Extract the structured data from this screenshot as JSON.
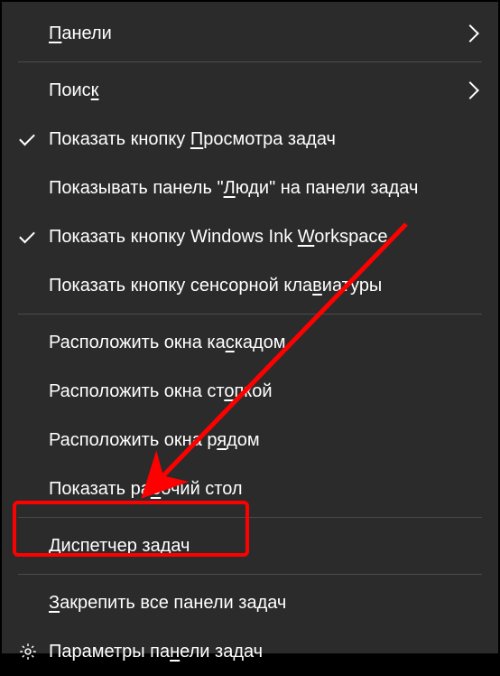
{
  "menu": {
    "panels": {
      "pre": "",
      "u": "П",
      "post": "анели"
    },
    "search": {
      "pre": "Поис",
      "u": "к",
      "post": ""
    },
    "taskview": {
      "pre": "Показать кнопку ",
      "u": "П",
      "post": "росмотра задач"
    },
    "people": {
      "pre": "Показывать панель \"",
      "u": "Л",
      "post": "юди\" на панели задач"
    },
    "ink": {
      "pre": "Показать кнопку Windows Ink ",
      "u": "W",
      "post": "orkspace"
    },
    "touchkb": {
      "pre": "Показать кнопку сенсорной кла",
      "u": "в",
      "post": "иатуры"
    },
    "cascade": {
      "pre": "Расположить окна ка",
      "u": "с",
      "post": "кадом"
    },
    "stack": {
      "pre": "Расположить окна ст",
      "u": "о",
      "post": "пкой"
    },
    "sidebyside": {
      "pre": "Расположить окна р",
      "u": "я",
      "post": "дом"
    },
    "showdesktop": {
      "pre": "Показать ра",
      "u": "б",
      "post": "очий стол"
    },
    "taskmgr": {
      "pre": "Диспет",
      "u": "ч",
      "post": "ер задач"
    },
    "lockall": {
      "pre": "",
      "u": "З",
      "post": "акрепить все панели задач"
    },
    "settings": {
      "pre": "Параметры па",
      "u": "н",
      "post": "ели задач"
    }
  },
  "annotation": {
    "highlight_target": "taskmgr",
    "arrow_color": "#ff0000"
  }
}
